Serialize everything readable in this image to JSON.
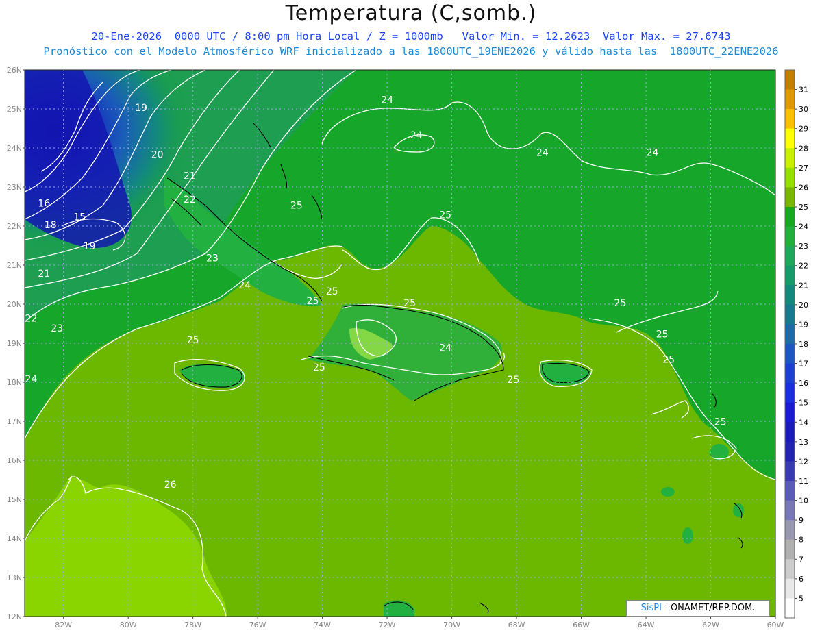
{
  "header": {
    "title": "Temperatura (C,somb.)",
    "line1": "20-Ene-2026  0000 UTC / 8:00 pm Hora Local / Z = 1000mb   Valor Min. = 12.2623  Valor Max. = 27.6743",
    "line2": "Pronóstico con el Modelo Atmosférico WRF inicializado a las 1800UTC_19ENE2026 y válido hasta las  1800UTC_22ENE2026"
  },
  "map": {
    "lat_labels": [
      "26N",
      "25N",
      "24N",
      "23N",
      "22N",
      "21N",
      "20N",
      "19N",
      "18N",
      "17N",
      "16N",
      "15N",
      "14N",
      "13N",
      "12N"
    ],
    "lon_labels": [
      "82W",
      "80W",
      "78W",
      "76W",
      "74W",
      "72W",
      "70W",
      "68W",
      "66W",
      "64W",
      "62W",
      "60W"
    ],
    "lat_range": [
      12,
      26
    ],
    "lon_range": [
      -83.2,
      -60
    ],
    "grid": "dotted",
    "contour_labels": [
      {
        "text": "24",
        "lon": -72.0,
        "lat": 25.15
      },
      {
        "text": "24",
        "lon": -71.1,
        "lat": 24.25
      },
      {
        "text": "24",
        "lon": -67.2,
        "lat": 23.8
      },
      {
        "text": "24",
        "lon": -63.8,
        "lat": 23.8
      },
      {
        "text": "19",
        "lon": -79.6,
        "lat": 24.95
      },
      {
        "text": "20",
        "lon": -79.1,
        "lat": 23.75
      },
      {
        "text": "21",
        "lon": -78.1,
        "lat": 23.2
      },
      {
        "text": "22",
        "lon": -78.1,
        "lat": 22.6
      },
      {
        "text": "16",
        "lon": -82.6,
        "lat": 22.5
      },
      {
        "text": "15",
        "lon": -81.5,
        "lat": 22.15
      },
      {
        "text": "18",
        "lon": -82.4,
        "lat": 21.95
      },
      {
        "text": "19",
        "lon": -81.2,
        "lat": 21.4
      },
      {
        "text": "21",
        "lon": -82.6,
        "lat": 20.7
      },
      {
        "text": "22",
        "lon": -83.0,
        "lat": 19.55
      },
      {
        "text": "23",
        "lon": -82.2,
        "lat": 19.3
      },
      {
        "text": "23",
        "lon": -77.4,
        "lat": 21.1
      },
      {
        "text": "24",
        "lon": -76.4,
        "lat": 20.4
      },
      {
        "text": "25",
        "lon": -74.8,
        "lat": 22.45
      },
      {
        "text": "25",
        "lon": -70.2,
        "lat": 22.2
      },
      {
        "text": "25",
        "lon": -73.7,
        "lat": 20.25
      },
      {
        "text": "25",
        "lon": -74.3,
        "lat": 20.0
      },
      {
        "text": "25",
        "lon": -71.3,
        "lat": 19.95
      },
      {
        "text": "25",
        "lon": -78.0,
        "lat": 19.0
      },
      {
        "text": "24",
        "lon": -83.0,
        "lat": 18.0
      },
      {
        "text": "25",
        "lon": -74.1,
        "lat": 18.3
      },
      {
        "text": "24",
        "lon": -70.2,
        "lat": 18.8
      },
      {
        "text": "25",
        "lon": -68.1,
        "lat": 17.98
      },
      {
        "text": "25",
        "lon": -64.8,
        "lat": 19.95
      },
      {
        "text": "25",
        "lon": -63.5,
        "lat": 19.15
      },
      {
        "text": "25",
        "lon": -63.3,
        "lat": 18.5
      },
      {
        "text": "25",
        "lon": -61.7,
        "lat": 16.9
      },
      {
        "text": "26",
        "lon": -78.7,
        "lat": 15.3
      }
    ]
  },
  "colorbar": {
    "labels": [
      "31",
      "30",
      "29",
      "28",
      "27",
      "26",
      "25",
      "24",
      "23",
      "22",
      "21",
      "20",
      "19",
      "18",
      "17",
      "16",
      "15",
      "14",
      "13",
      "12",
      "11",
      "10",
      "9",
      "8",
      "7",
      "6",
      "5"
    ],
    "colors": [
      "#c38000",
      "#e09a00",
      "#ffc000",
      "#ffff00",
      "#c8f000",
      "#96e000",
      "#7ab800",
      "#18a820",
      "#22b03a",
      "#1ea85a",
      "#169a6a",
      "#12897c",
      "#147a8c",
      "#1c6aa8",
      "#1b56c0",
      "#1b3fd0",
      "#1a2ee0",
      "#1a1ad2",
      "#1a1ab8",
      "#2222b0",
      "#3a3ab0",
      "#5a5ab8",
      "#7878b8",
      "#9898b0",
      "#b0b0b0",
      "#cccccc",
      "#e8e8e8",
      "#ffffff"
    ]
  },
  "credit": {
    "brand": "SisPI",
    "text": " - ONAMET/REP.DOM."
  }
}
